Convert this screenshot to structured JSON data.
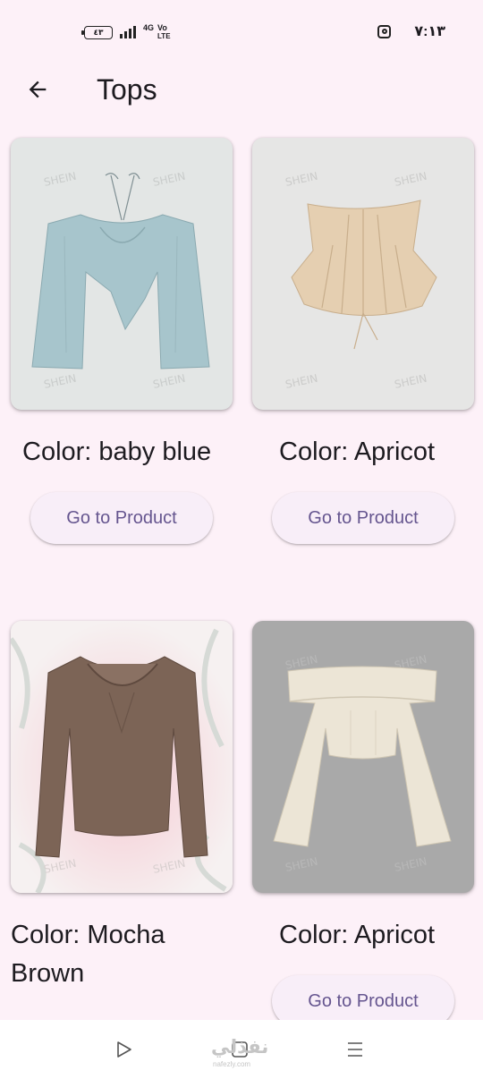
{
  "status_bar": {
    "battery": "٤٣",
    "network_label_top": "4G",
    "network_label_vo": "Vo",
    "network_label_lte": "LTE",
    "time": "٧:١٣",
    "icons": [
      "battery-icon",
      "signal-icon",
      "network-icon",
      "instagram-icon"
    ]
  },
  "app_bar": {
    "title": "Tops",
    "back_icon": "arrow-left-icon"
  },
  "products": [
    {
      "color_label": "Color: baby blue",
      "button_label": "Go to Product",
      "image_watermark": "SHEIN",
      "garment_color": "#a7c5cc"
    },
    {
      "color_label": "Color: Apricot",
      "button_label": "Go to Product",
      "image_watermark": "SHEIN",
      "garment_color": "#e5cfb1"
    },
    {
      "color_label": "Color: Mocha Brown",
      "color_label_line1": "Color: Mocha",
      "color_label_line2": "Brown",
      "button_label": "Go to Product",
      "image_watermark": "SHEIN",
      "garment_color": "#7c6456"
    },
    {
      "color_label": "Color: Apricot",
      "button_label": "Go to Product",
      "image_watermark": "SHEIN",
      "garment_color": "#ece5d6"
    }
  ],
  "nav_bar": {
    "icons": [
      "back-triangle-icon",
      "home-square-icon",
      "recents-menu-icon"
    ],
    "watermark": "نفذلي",
    "watermark_url": "nafezly.com"
  }
}
